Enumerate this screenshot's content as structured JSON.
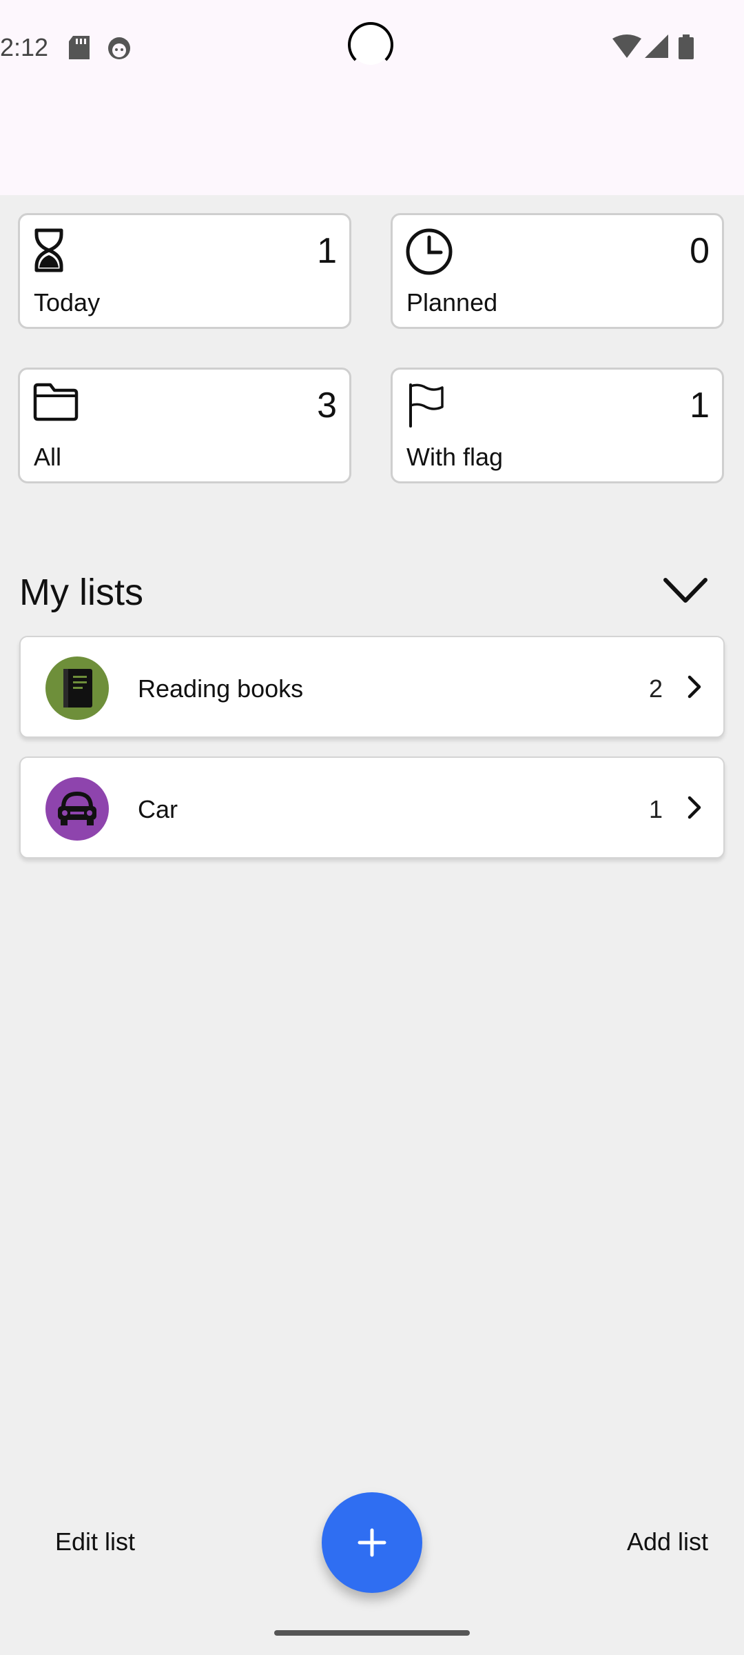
{
  "status_bar": {
    "time": "2:12",
    "icons": [
      "sd-card-icon",
      "face-icon",
      "wifi-icon",
      "signal-icon",
      "battery-icon"
    ]
  },
  "summary_cards": [
    {
      "label": "Today",
      "count": "1",
      "icon": "hourglass-icon"
    },
    {
      "label": "Planned",
      "count": "0",
      "icon": "clock-icon"
    },
    {
      "label": "All",
      "count": "3",
      "icon": "folder-icon"
    },
    {
      "label": "With flag",
      "count": "1",
      "icon": "flag-icon"
    }
  ],
  "my_lists": {
    "title": "My lists",
    "items": [
      {
        "name": "Reading books",
        "count": "2",
        "icon": "book-icon",
        "color": "#6e8f3a"
      },
      {
        "name": "Car",
        "count": "1",
        "icon": "car-icon",
        "color": "#8e44ad"
      }
    ]
  },
  "bottom_bar": {
    "edit_label": "Edit list",
    "add_label": "Add list",
    "fab_icon": "plus-icon",
    "fab_color": "#2f6ef2"
  }
}
